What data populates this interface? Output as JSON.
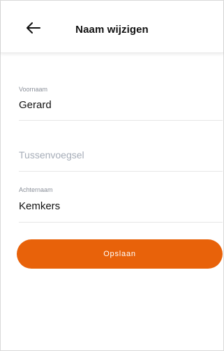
{
  "header": {
    "title": "Naam wijzigen",
    "back_icon": "arrow-left-icon"
  },
  "form": {
    "first_name": {
      "label": "Voornaam",
      "value": "Gerard"
    },
    "infix": {
      "placeholder": "Tussenvoegsel",
      "value": ""
    },
    "last_name": {
      "label": "Achternaam",
      "value": "Kemkers"
    }
  },
  "actions": {
    "save_label": "Opslaan"
  },
  "colors": {
    "accent": "#e8620a",
    "text": "#111111",
    "muted": "#8a8f99",
    "placeholder": "#a6adb8",
    "divider": "#e6e6e6"
  }
}
